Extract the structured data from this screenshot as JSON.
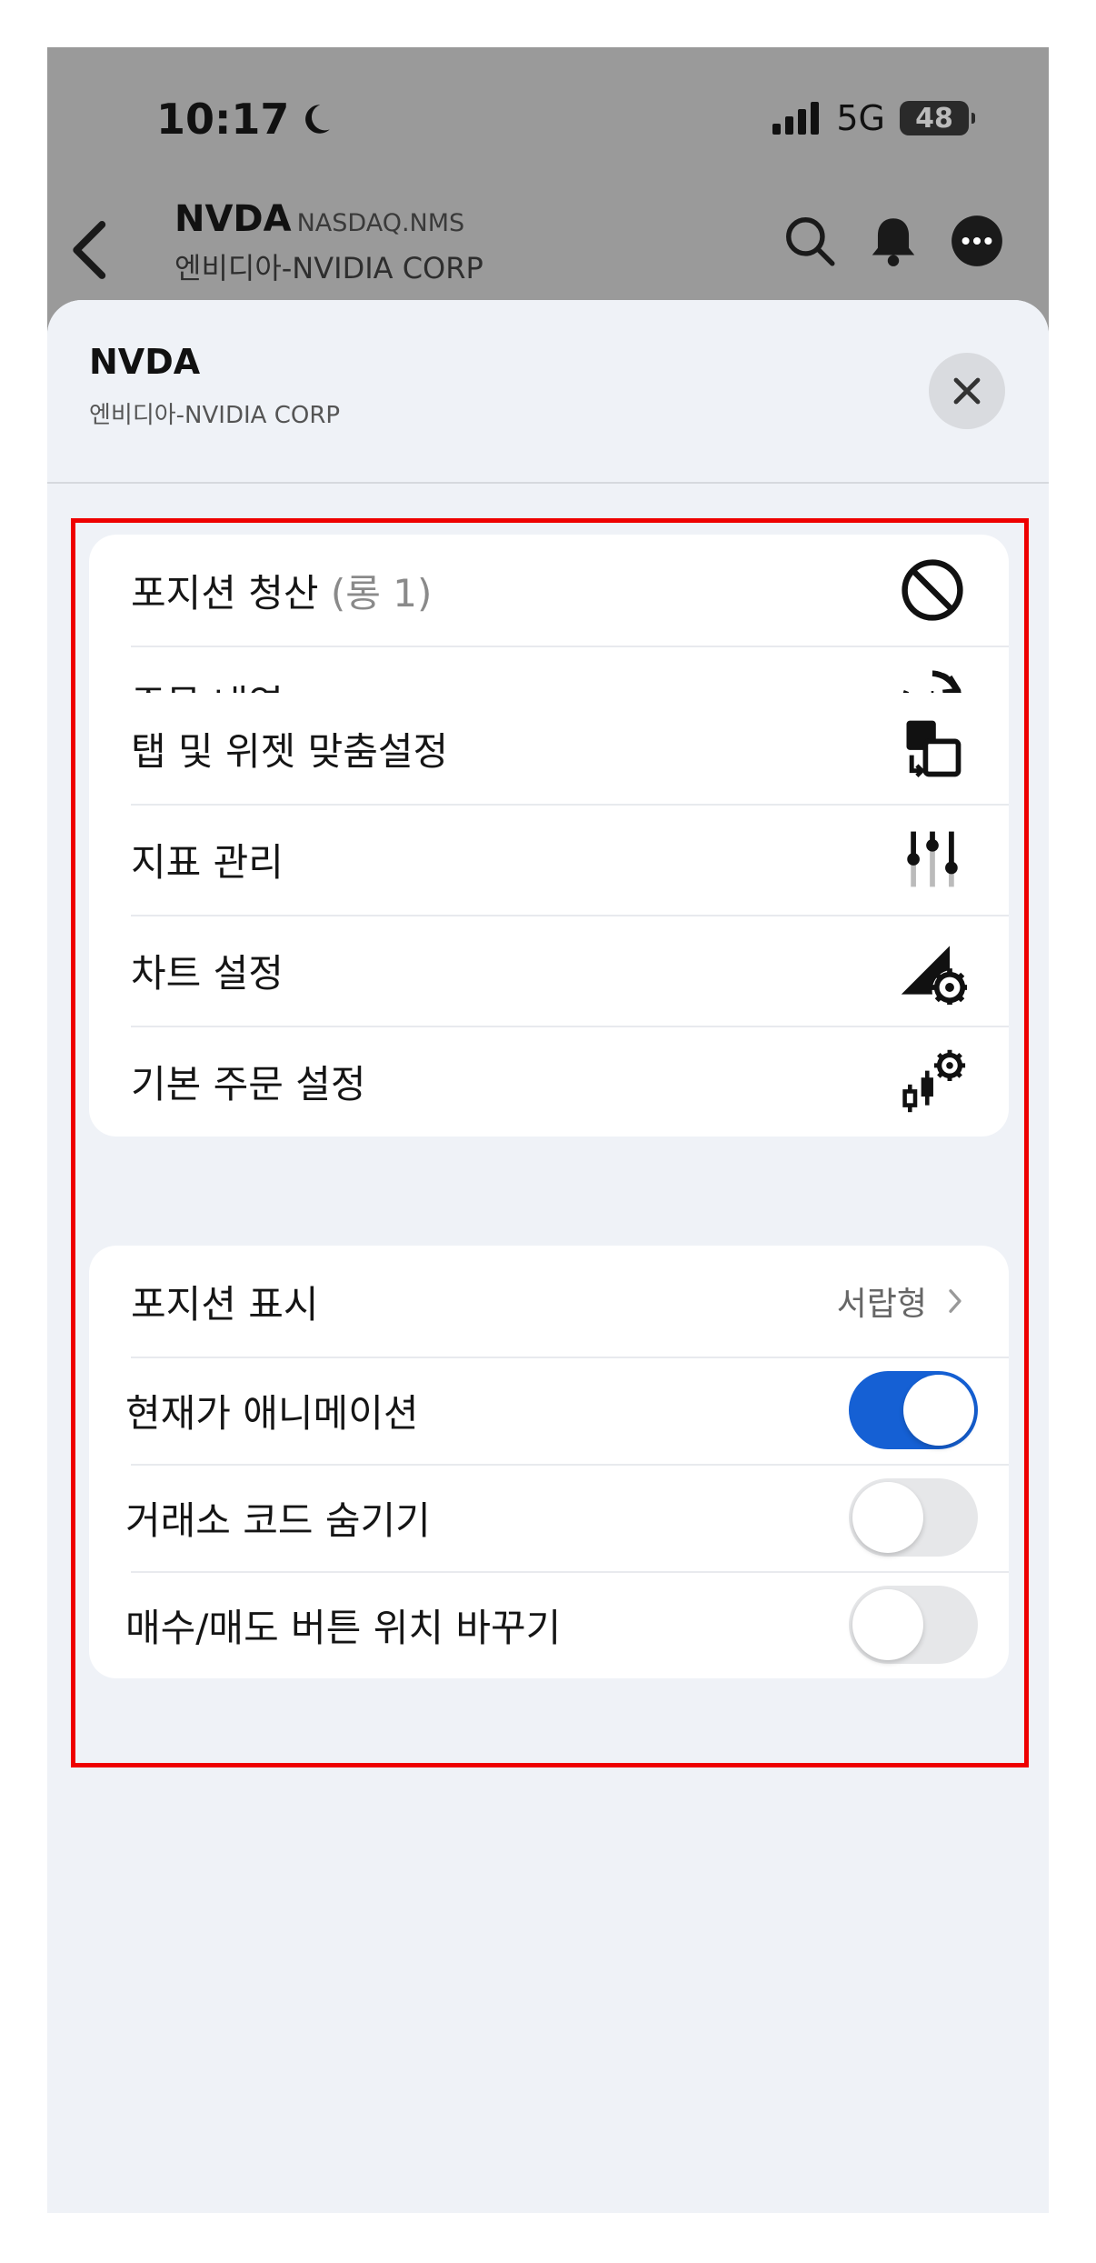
{
  "status_bar": {
    "time": "10:17",
    "network": "5G",
    "battery": "48"
  },
  "header": {
    "symbol": "NVDA",
    "exchange": "NASDAQ.NMS",
    "name": "엔비디아-NVIDIA CORP"
  },
  "sheet": {
    "symbol": "NVDA",
    "name": "엔비디아-NVIDIA CORP",
    "group1": [
      {
        "label": "포지션 청산",
        "sub": "(롱 1)",
        "icon": "prohibit-icon"
      },
      {
        "label": "주문 내역",
        "icon": "order-history-icon"
      }
    ],
    "group2": [
      {
        "label": "탭 및 위젯 맞춤설정",
        "icon": "widget-swap-icon"
      },
      {
        "label": "지표 관리",
        "icon": "sliders-icon"
      },
      {
        "label": "차트 설정",
        "icon": "chart-gear-icon"
      },
      {
        "label": "기본 주문 설정",
        "icon": "candles-gear-icon"
      }
    ],
    "group3": {
      "position_display": {
        "label": "포지션 표시",
        "value": "서랍형"
      },
      "toggles": [
        {
          "label": "현재가 애니메이션",
          "on": true
        },
        {
          "label": "거래소 코드 숨기기",
          "on": false
        },
        {
          "label": "매수/매도 버튼 위치 바꾸기",
          "on": false
        }
      ]
    }
  },
  "colors": {
    "accent": "#1560d4",
    "highlight": "#e00000"
  }
}
